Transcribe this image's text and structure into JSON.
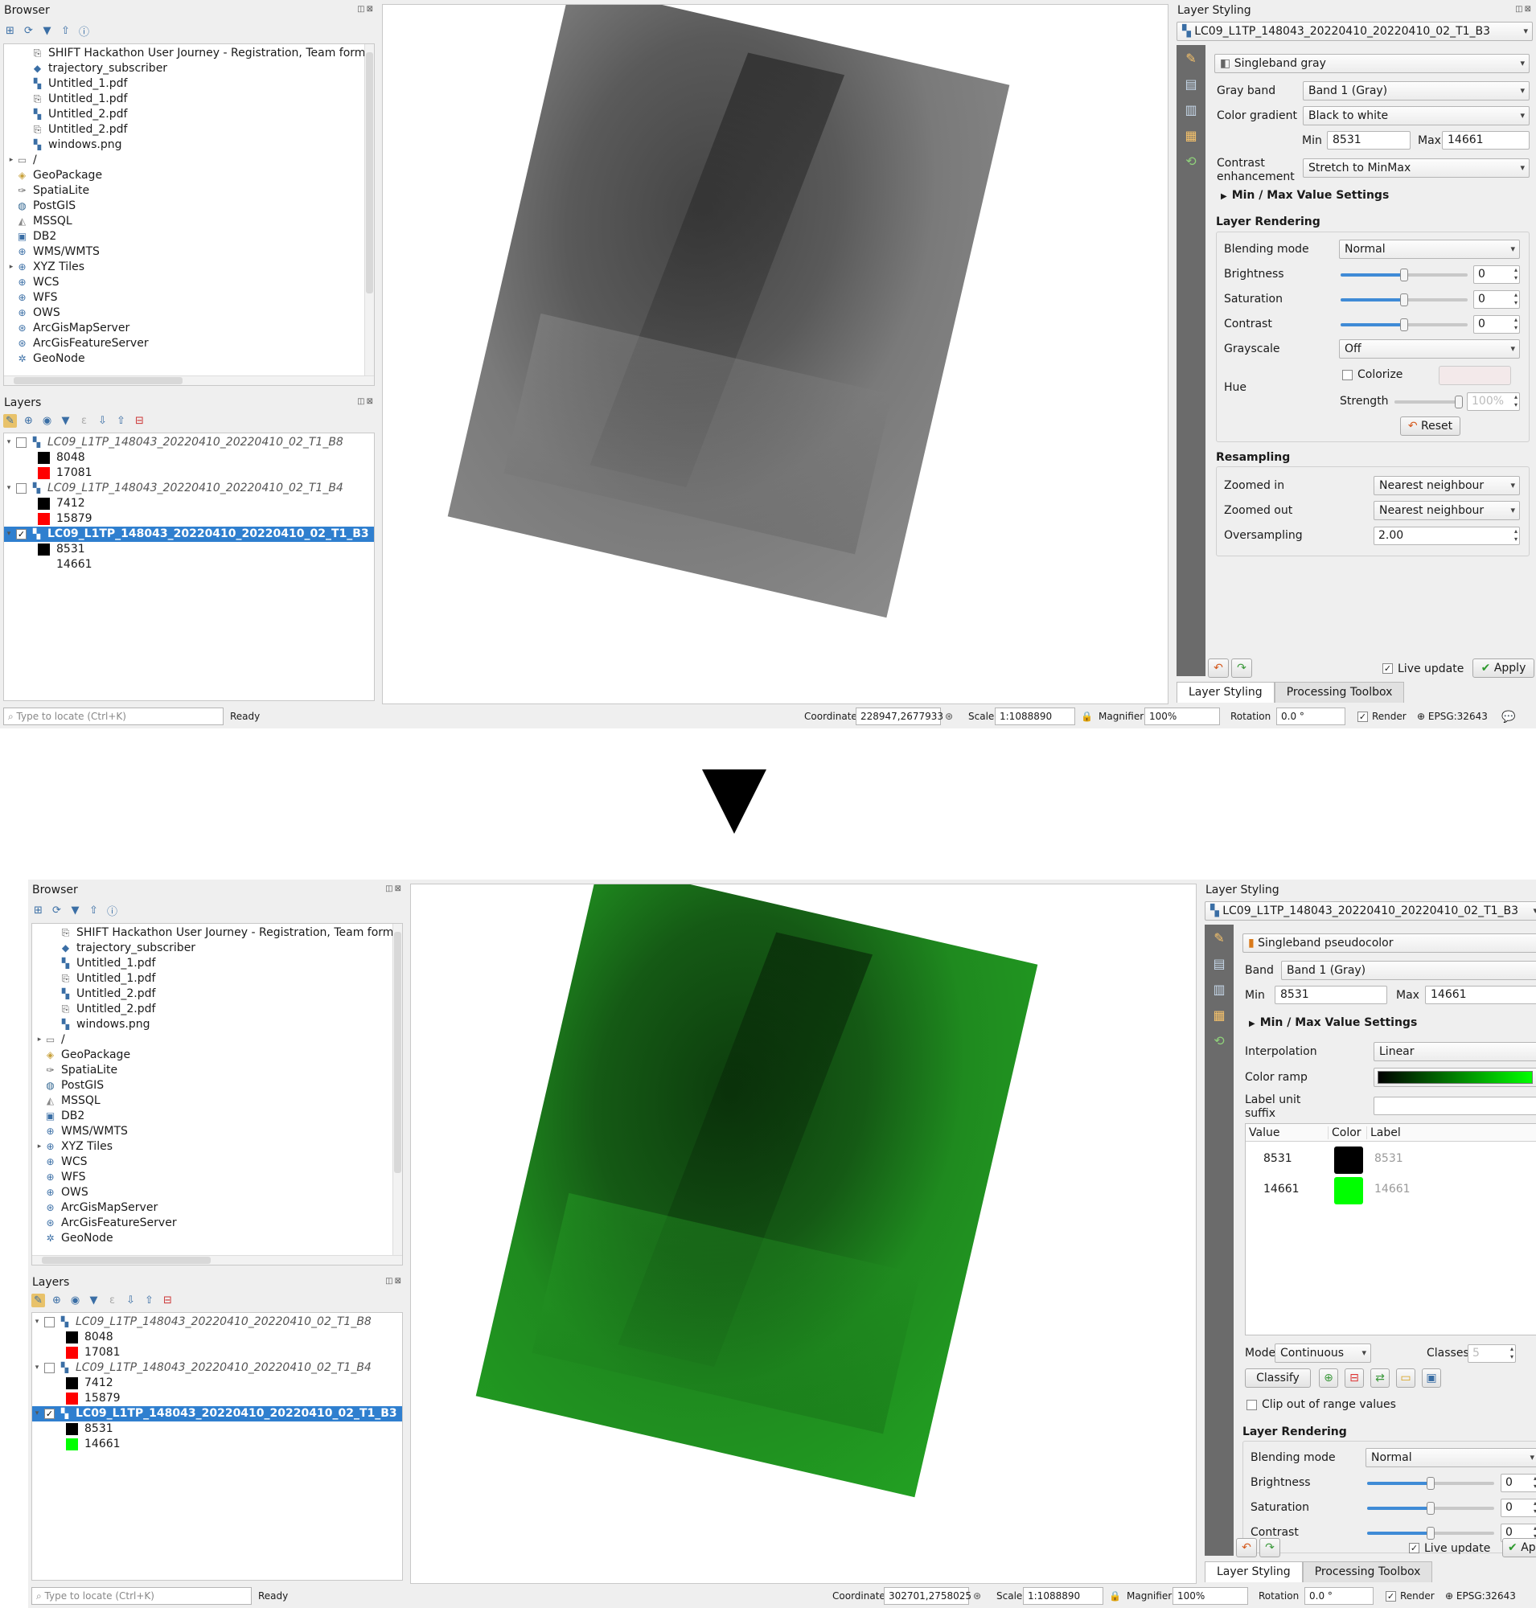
{
  "browser": {
    "title": "Browser",
    "items": [
      {
        "label": "SHIFT Hackathon User Journey - Registration, Team form",
        "icon": "pdf-link-icon",
        "indent": 2
      },
      {
        "label": "trajectory_subscriber",
        "icon": "python-icon",
        "indent": 2
      },
      {
        "label": "Untitled_1.pdf",
        "icon": "raster-icon",
        "indent": 2
      },
      {
        "label": "Untitled_1.pdf",
        "icon": "pdf-link-icon",
        "indent": 2
      },
      {
        "label": "Untitled_2.pdf",
        "icon": "raster-icon",
        "indent": 2
      },
      {
        "label": "Untitled_2.pdf",
        "icon": "pdf-link-icon",
        "indent": 2
      },
      {
        "label": "windows.png",
        "icon": "raster-icon",
        "indent": 2
      },
      {
        "label": "/",
        "icon": "folder-icon",
        "indent": 1,
        "expandable": true
      },
      {
        "label": "GeoPackage",
        "icon": "geopackage-icon",
        "indent": 1
      },
      {
        "label": "SpatiaLite",
        "icon": "spatialite-icon",
        "indent": 1
      },
      {
        "label": "PostGIS",
        "icon": "postgis-icon",
        "indent": 1
      },
      {
        "label": "MSSQL",
        "icon": "mssql-icon",
        "indent": 1
      },
      {
        "label": "DB2",
        "icon": "db2-icon",
        "indent": 1
      },
      {
        "label": "WMS/WMTS",
        "icon": "globe-icon",
        "indent": 1
      },
      {
        "label": "XYZ Tiles",
        "icon": "globe-icon",
        "indent": 1,
        "expandable": true
      },
      {
        "label": "WCS",
        "icon": "globe-icon",
        "indent": 1
      },
      {
        "label": "WFS",
        "icon": "globe-icon",
        "indent": 1
      },
      {
        "label": "OWS",
        "icon": "globe-icon",
        "indent": 1
      },
      {
        "label": "ArcGisMapServer",
        "icon": "arcgis-icon",
        "indent": 1
      },
      {
        "label": "ArcGisFeatureServer",
        "icon": "arcgis-icon",
        "indent": 1
      },
      {
        "label": "GeoNode",
        "icon": "geonode-icon",
        "indent": 1
      }
    ]
  },
  "layers_title": "Layers",
  "before": {
    "layers": [
      {
        "name": "LC09_L1TP_148043_20220410_20220410_02_T1_B8",
        "checked": false,
        "selected": false,
        "legend": [
          {
            "label": "8048",
            "color": "#000000"
          },
          {
            "label": "17081",
            "color": "#ff0000"
          }
        ]
      },
      {
        "name": "LC09_L1TP_148043_20220410_20220410_02_T1_B4",
        "checked": false,
        "selected": false,
        "legend": [
          {
            "label": "7412",
            "color": "#000000"
          },
          {
            "label": "15879",
            "color": "#ff0000"
          }
        ]
      },
      {
        "name": "LC09_L1TP_148043_20220410_20220410_02_T1_B3",
        "checked": true,
        "selected": true,
        "legend": [
          {
            "label": "8531",
            "color": "#000000"
          },
          {
            "label": "14661",
            "color": ""
          }
        ]
      }
    ],
    "styling": {
      "title": "Layer Styling",
      "layer_combo": "LC09_L1TP_148043_20220410_20220410_02_T1_B3",
      "renderer": "Singleband gray",
      "gray_band_label": "Gray band",
      "gray_band": "Band 1 (Gray)",
      "color_gradient_label": "Color gradient",
      "color_gradient": "Black to white",
      "min_label": "Min",
      "min": "8531",
      "max_label": "Max",
      "max": "14661",
      "contrast_label_1": "Contrast",
      "contrast_label_2": "enhancement",
      "contrast": "Stretch to MinMax",
      "minmax_settings": "Min / Max Value Settings",
      "layer_rendering": "Layer Rendering",
      "blending_label": "Blending mode",
      "blending": "Normal",
      "brightness_label": "Brightness",
      "brightness": "0",
      "saturation_label": "Saturation",
      "saturation": "0",
      "contrast_r_label": "Contrast",
      "contrast_r": "0",
      "grayscale_label": "Grayscale",
      "grayscale": "Off",
      "hue_label": "Hue",
      "colorize_label": "Colorize",
      "strength_label": "Strength",
      "strength": "100%",
      "reset": "Reset",
      "resampling": "Resampling",
      "zoomed_in_label": "Zoomed in",
      "zoomed_in": "Nearest neighbour",
      "zoomed_out_label": "Zoomed out",
      "zoomed_out": "Nearest neighbour",
      "oversampling_label": "Oversampling",
      "oversampling": "2.00",
      "live_update": "Live update",
      "apply": "Apply"
    },
    "status": {
      "coordinate": "228947,2677933",
      "scale": "1:1088890"
    }
  },
  "after": {
    "layers": [
      {
        "name": "LC09_L1TP_148043_20220410_20220410_02_T1_B8",
        "checked": false,
        "selected": false,
        "legend": [
          {
            "label": "8048",
            "color": "#000000"
          },
          {
            "label": "17081",
            "color": "#ff0000"
          }
        ]
      },
      {
        "name": "LC09_L1TP_148043_20220410_20220410_02_T1_B4",
        "checked": false,
        "selected": false,
        "legend": [
          {
            "label": "7412",
            "color": "#000000"
          },
          {
            "label": "15879",
            "color": "#ff0000"
          }
        ]
      },
      {
        "name": "LC09_L1TP_148043_20220410_20220410_02_T1_B3",
        "checked": true,
        "selected": true,
        "legend": [
          {
            "label": "8531",
            "color": "#000000"
          },
          {
            "label": "14661",
            "color": "#00ff00"
          }
        ]
      }
    ],
    "styling": {
      "title": "Layer Styling",
      "layer_combo": "LC09_L1TP_148043_20220410_20220410_02_T1_B3",
      "renderer": "Singleband pseudocolor",
      "band_label": "Band",
      "band": "Band 1 (Gray)",
      "min_label": "Min",
      "min": "8531",
      "max_label": "Max",
      "max": "14661",
      "minmax_settings": "Min / Max Value Settings",
      "interpolation_label": "Interpolation",
      "interpolation": "Linear",
      "color_ramp_label": "Color ramp",
      "label_unit_1": "Label unit",
      "label_unit_2": "suffix",
      "col_value": "Value",
      "col_color": "Color",
      "col_label": "Label",
      "entries": [
        {
          "value": "8531",
          "color": "#000000",
          "label": "8531"
        },
        {
          "value": "14661",
          "color": "#00ff00",
          "label": "14661"
        }
      ],
      "mode_label": "Mode",
      "mode": "Continuous",
      "classes_label": "Classes",
      "classes": "5",
      "classify": "Classify",
      "clip_label": "Clip out of range values",
      "layer_rendering": "Layer Rendering",
      "blending_label": "Blending mode",
      "blending": "Normal",
      "brightness_label": "Brightness",
      "brightness": "0",
      "saturation_label": "Saturation",
      "saturation": "0",
      "contrast_r_label": "Contrast",
      "contrast_r": "0",
      "live_update": "Live update",
      "apply": "Ap"
    },
    "status": {
      "coordinate": "302701,2758025",
      "scale": "1:1088890"
    }
  },
  "common_status": {
    "locate_placeholder": "Type to locate (Ctrl+K)",
    "ready": "Ready",
    "coordinate_label": "Coordinate",
    "scale_label": "Scale",
    "magnifier_label": "Magnifier",
    "magnifier": "100%",
    "rotation_label": "Rotation",
    "rotation": "0.0 °",
    "render_label": "Render",
    "crs": "EPSG:32643"
  },
  "tabs": {
    "layer_styling": "Layer Styling",
    "processing_toolbox": "Processing Toolbox"
  },
  "colors": {
    "selection": "#2f7fcf",
    "accent": "#3f8bd6",
    "green": "#00ff00"
  }
}
